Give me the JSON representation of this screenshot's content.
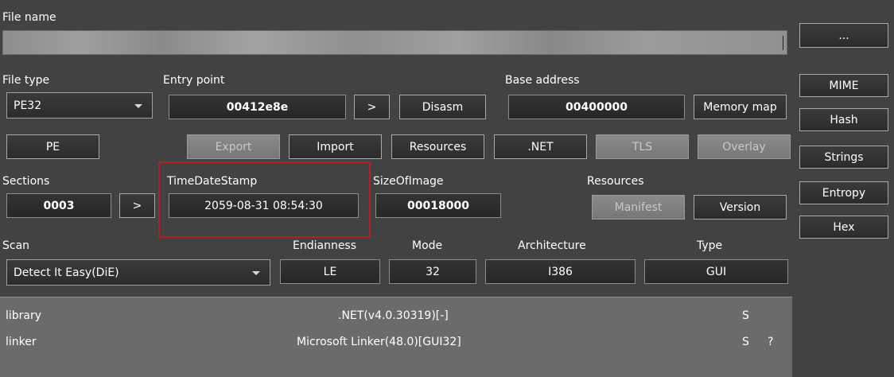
{
  "file_name": {
    "label": "File name",
    "value": ""
  },
  "side_buttons": {
    "browse": "...",
    "mime": "MIME",
    "hash": "Hash",
    "strings": "Strings",
    "entropy": "Entropy",
    "hex": "Hex"
  },
  "file_type": {
    "label": "File type",
    "value": "PE32"
  },
  "entry_point": {
    "label": "Entry point",
    "value": "00412e8e",
    "go": ">",
    "disasm": "Disasm"
  },
  "base_address": {
    "label": "Base address",
    "value": "00400000",
    "memory_map": "Memory map"
  },
  "pe_buttons": {
    "pe": "PE",
    "export": "Export",
    "import": "Import",
    "resources": "Resources",
    "net": ".NET",
    "tls": "TLS",
    "overlay": "Overlay"
  },
  "sections": {
    "label": "Sections",
    "value": "0003",
    "go": ">"
  },
  "time_date_stamp": {
    "label": "TimeDateStamp",
    "value": "2059-08-31 08:54:30"
  },
  "size_of_image": {
    "label": "SizeOfImage",
    "value": "00018000"
  },
  "resources_group": {
    "label": "Resources",
    "manifest": "Manifest",
    "version": "Version"
  },
  "scan": {
    "label": "Scan",
    "value": "Detect It Easy(DiE)"
  },
  "endianness": {
    "label": "Endianness",
    "value": "LE"
  },
  "mode": {
    "label": "Mode",
    "value": "32"
  },
  "architecture": {
    "label": "Architecture",
    "value": "I386"
  },
  "type": {
    "label": "Type",
    "value": "GUI"
  },
  "results": [
    {
      "kind": "library",
      "name": ".NET(v4.0.30319)[-]",
      "flag": "S",
      "extra": ""
    },
    {
      "kind": "linker",
      "name": "Microsoft Linker(48.0)[GUI32]",
      "flag": "S",
      "extra": "?"
    }
  ],
  "colors": {
    "background": "#424242",
    "highlight": "#b22222",
    "results_bg": "#6b6b6b"
  }
}
